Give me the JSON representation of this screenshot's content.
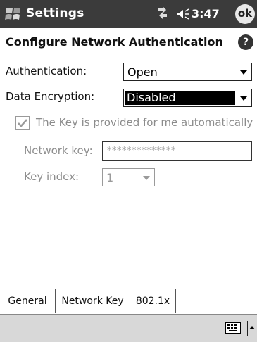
{
  "titlebar": {
    "app_title": "Settings",
    "time": "3:47",
    "ok_label": "ok"
  },
  "header": {
    "title": "Configure Network Authentication",
    "help_label": "?"
  },
  "form": {
    "authentication_label": "Authentication:",
    "authentication_value": "Open",
    "encryption_label": "Data Encryption:",
    "encryption_value": "Disabled",
    "key_auto_label": "The Key is provided for me automatically",
    "key_auto_checked": true,
    "network_key_label": "Network key:",
    "network_key_value": "**************",
    "key_index_label": "Key index:",
    "key_index_value": "1"
  },
  "tabs": [
    {
      "label": "General",
      "active": false
    },
    {
      "label": "Network Key",
      "active": true
    },
    {
      "label": "802.1x",
      "active": false
    }
  ],
  "icons": [
    "windows-start-icon",
    "connectivity-icon",
    "volume-icon",
    "help-icon",
    "keyboard-icon",
    "input-panel-arrow-icon"
  ]
}
